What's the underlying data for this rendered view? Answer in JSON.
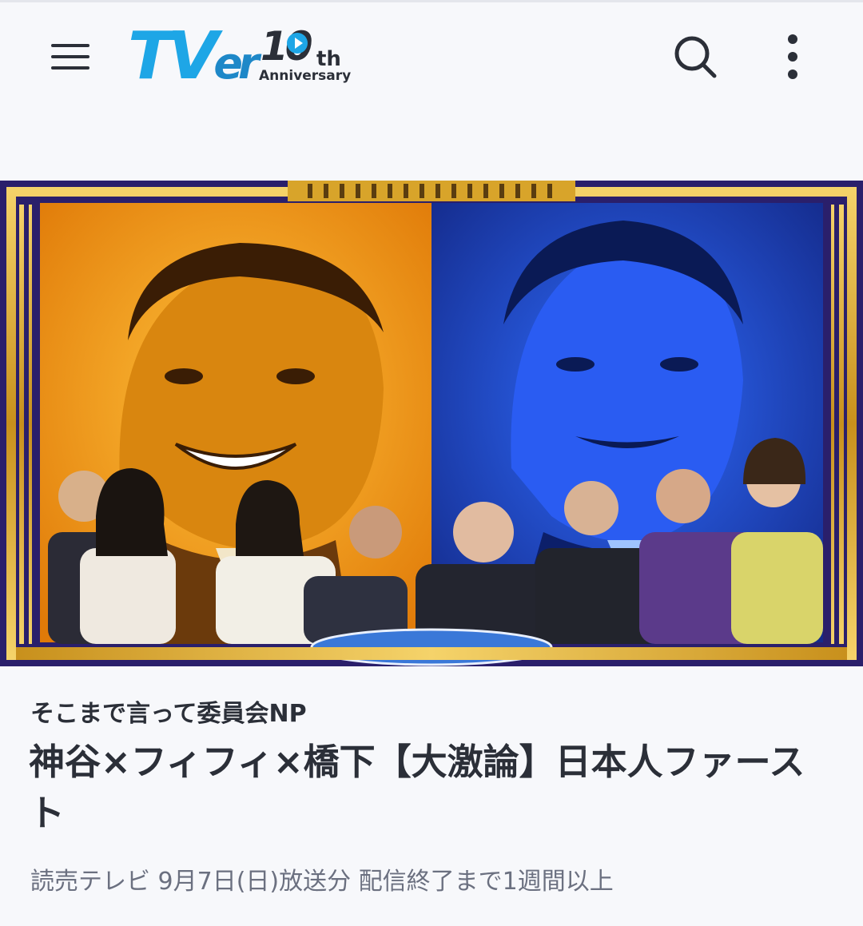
{
  "header": {
    "logo": {
      "t": "T",
      "v": "V",
      "er": "er",
      "ten": "10",
      "th": "th",
      "anniversary": "Anniversary"
    }
  },
  "program": {
    "series_title": "そこまで言って委員会NP",
    "episode_title": "神谷×フィフィ×橋下【大激論】日本人ファースト",
    "broadcaster": "読売テレビ",
    "air_date": "9月7日(日)放送分",
    "availability": "配信終了まで1週間以上"
  },
  "icons": {
    "menu": "hamburger-menu-icon",
    "search": "search-icon",
    "more": "more-vertical-icon",
    "logo_play": "play-icon"
  },
  "colors": {
    "brand": "#1ea6e6",
    "text": "#2b2f38",
    "subtext": "#6b7080",
    "thumbnail_left": "#f29a12",
    "thumbnail_right": "#1e3aa8",
    "frame_gold": "#d8a42a",
    "frame_purple": "#2a1f6b"
  }
}
